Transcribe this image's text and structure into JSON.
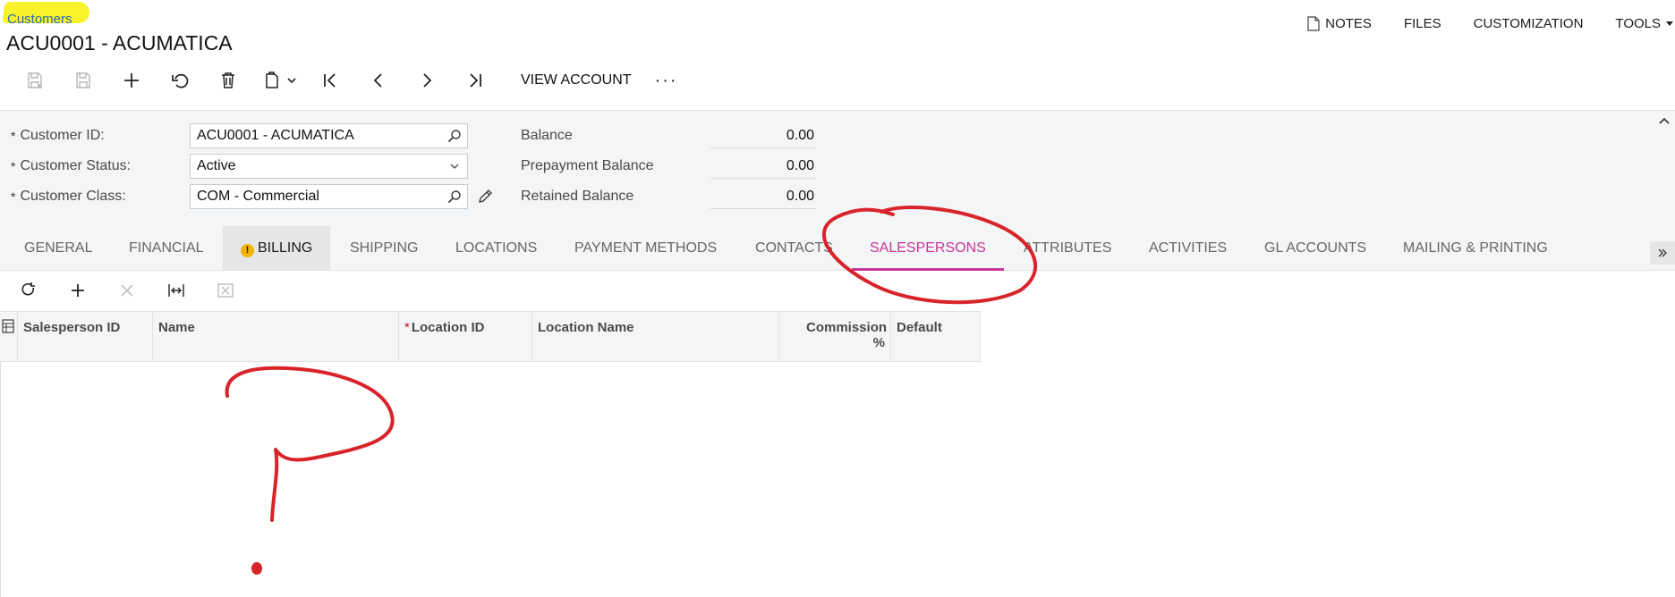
{
  "breadcrumb": "Customers",
  "page_title": "ACU0001 - ACUMATICA",
  "top_actions": {
    "notes": "NOTES",
    "files": "FILES",
    "customization": "CUSTOMIZATION",
    "tools": "TOOLS"
  },
  "toolbar": {
    "view_account": "VIEW ACCOUNT",
    "more": "···"
  },
  "form": {
    "customer_id_label": "Customer ID:",
    "customer_id_value": "ACU0001 - ACUMATICA",
    "customer_status_label": "Customer Status:",
    "customer_status_value": "Active",
    "customer_class_label": "Customer Class:",
    "customer_class_value": "COM - Commercial",
    "required_mark": "*"
  },
  "balances": {
    "balance_label": "Balance",
    "balance_value": "0.00",
    "prepayment_label": "Prepayment Balance",
    "prepayment_value": "0.00",
    "retained_label": "Retained Balance",
    "retained_value": "0.00"
  },
  "tabs": [
    {
      "label": "GENERAL"
    },
    {
      "label": "FINANCIAL"
    },
    {
      "label": "BILLING",
      "warning": true
    },
    {
      "label": "SHIPPING"
    },
    {
      "label": "LOCATIONS"
    },
    {
      "label": "PAYMENT METHODS"
    },
    {
      "label": "CONTACTS"
    },
    {
      "label": "SALESPERSONS",
      "active": true
    },
    {
      "label": "ATTRIBUTES"
    },
    {
      "label": "ACTIVITIES"
    },
    {
      "label": "GL ACCOUNTS"
    },
    {
      "label": "MAILING & PRINTING"
    }
  ],
  "warning_glyph": "!",
  "grid": {
    "columns": [
      {
        "label": "Salesperson ID"
      },
      {
        "label": "Name"
      },
      {
        "label": "Location ID",
        "required": true
      },
      {
        "label": "Location Name"
      },
      {
        "label": "Commission %"
      },
      {
        "label": "Default"
      }
    ],
    "rows": []
  },
  "colors": {
    "active_tab": "#c63597",
    "highlight": "#f7f22a",
    "annotation": "#d9232b",
    "warning": "#f2b400"
  },
  "icons": [
    "save-close-icon",
    "save-icon",
    "add-icon",
    "undo-icon",
    "delete-icon",
    "copy-paste-icon",
    "first-record-icon",
    "previous-record-icon",
    "next-record-icon",
    "last-record-icon",
    "refresh-icon",
    "fit-columns-icon",
    "export-excel-icon",
    "search-icon",
    "chevron-down-icon",
    "pencil-icon",
    "document-icon",
    "collapse-icon",
    "warning-icon",
    "column-config-icon"
  ]
}
